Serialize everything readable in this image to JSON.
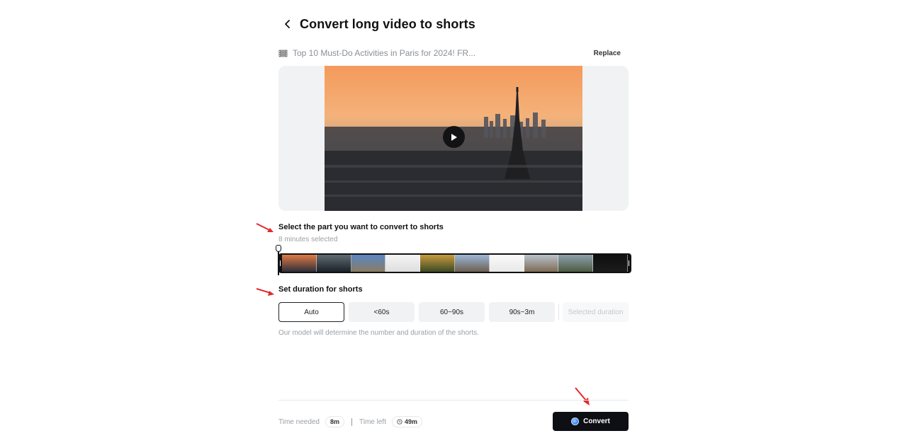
{
  "header": {
    "title": "Convert long video to shorts"
  },
  "source": {
    "name": "Top 10 Must-Do Activities in Paris for 2024! FR...",
    "replace_label": "Replace"
  },
  "part_section": {
    "title": "Select the part you want to convert to shorts",
    "selected_text": "8 minutes selected"
  },
  "timeline": {
    "frames": [
      {
        "top": "#e07a45",
        "bottom": "#2d2f3a"
      },
      {
        "top": "#5f6b72",
        "bottom": "#1b2228"
      },
      {
        "top": "#5a86c4",
        "bottom": "#8a7c62"
      },
      {
        "top": "#f4f4f4",
        "bottom": "#dedede"
      },
      {
        "top": "#c89a3e",
        "bottom": "#3d4a26"
      },
      {
        "top": "#9cb7d8",
        "bottom": "#6c5f50"
      },
      {
        "top": "#fafafa",
        "bottom": "#e8e8e8"
      },
      {
        "top": "#b9c3cc",
        "bottom": "#7d6a55"
      },
      {
        "top": "#8ea0ae",
        "bottom": "#4d5b42"
      },
      {
        "top": "#0f0f10",
        "bottom": "#1b1b1c"
      }
    ]
  },
  "duration_section": {
    "title": "Set duration for shorts",
    "options": [
      "Auto",
      "<60s",
      "60~90s",
      "90s~3m"
    ],
    "selected_index": 0,
    "custom_label": "Selected duration",
    "hint": "Our model will determine the number and duration of the shorts."
  },
  "footer": {
    "time_needed_label": "Time needed",
    "time_needed_value": "8m",
    "time_left_label": "Time left",
    "time_left_value": "49m"
  },
  "convert_label": "Convert",
  "icons": {
    "back": "chevron-left-icon",
    "source": "film-icon",
    "play": "play-icon",
    "clock": "clock-icon",
    "convert": "spark-dot-icon"
  }
}
